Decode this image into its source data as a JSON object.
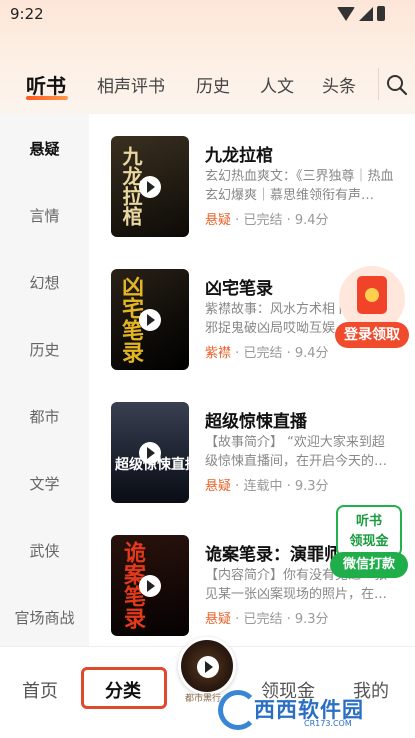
{
  "status": {
    "time": "9:22"
  },
  "tabs": [
    {
      "label": "听书",
      "active": true
    },
    {
      "label": "相声评书"
    },
    {
      "label": "历史"
    },
    {
      "label": "人文"
    },
    {
      "label": "头条"
    }
  ],
  "sidebar": {
    "items": [
      {
        "label": "悬疑",
        "active": true
      },
      {
        "label": "言情"
      },
      {
        "label": "幻想"
      },
      {
        "label": "历史"
      },
      {
        "label": "都市"
      },
      {
        "label": "文学"
      },
      {
        "label": "武侠"
      },
      {
        "label": "官场商战"
      }
    ]
  },
  "books": [
    {
      "title": "九龙拉棺",
      "desc": "玄幻热血爽文：《三界独尊｜热血玄幻爆爽｜慕思维领衔有声…",
      "tag": "悬疑",
      "status": "已完结",
      "score": "9.4分",
      "cover_text": "九龙拉棺",
      "cover_color": "#2b2418"
    },
    {
      "title": "凶宅笔录",
      "desc": "紫襟故事：风水方术相卜命理，邪捉鬼破凶局哎呦互娱…",
      "tag": "紫襟",
      "status": "已完结",
      "score": "9.4分",
      "cover_text": "凶宅笔录",
      "cover_color": "#1a1612"
    },
    {
      "title": "超级惊悚直播",
      "desc": "【故事简介】 “欢迎大家来到超级惊悚直播间，在开启今天的…",
      "tag": "悬疑",
      "status": "连载中",
      "score": "9.3分",
      "cover_text": "超级惊悚直播",
      "cover_color": "#1c2230"
    },
    {
      "title": "诡案笔录：演罪师",
      "desc": "【内容简介】你有没有见过一张见某一张凶案现场的照片，在…",
      "tag": "悬疑",
      "status": "已完结",
      "score": "9.3分",
      "cover_text": "诡案笔录",
      "cover_color": "#140c0a"
    }
  ],
  "separator": "·",
  "widgets": {
    "redpacket_label": "登录领取",
    "wechat_line1": "听书",
    "wechat_line2": "领现金",
    "wechat_button": "微信打款"
  },
  "bottomnav": {
    "items": [
      {
        "label": "首页"
      },
      {
        "label": "分类",
        "active": true
      },
      {
        "label": "领现金"
      },
      {
        "label": "我的"
      }
    ],
    "player_label": "都市黑行"
  },
  "watermark": {
    "text": "西西软件园",
    "sub": "CR173.COM"
  },
  "colors": {
    "accent": "#e8622a",
    "green": "#1fae4a",
    "red": "#ef4b2c"
  }
}
